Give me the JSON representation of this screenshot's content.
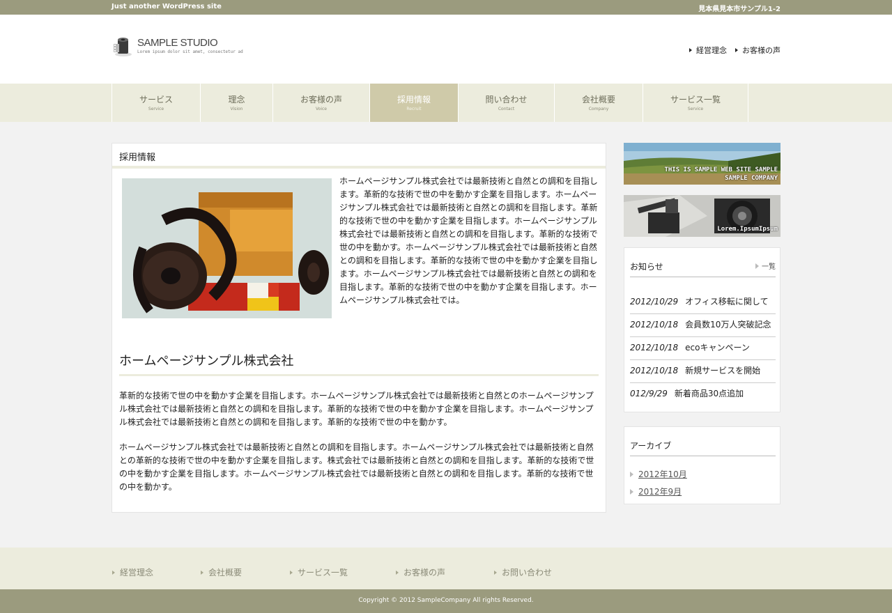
{
  "topbar": {
    "tagline": "Just another WordPress site",
    "address": "見本県見本市サンプル1-2"
  },
  "logo": {
    "name": "SAMPLE STUDIO",
    "sub": "Lorem ipsum dolor sit amet, consectetur ad"
  },
  "header_links": [
    {
      "label": "経営理念"
    },
    {
      "label": "お客様の声"
    }
  ],
  "nav": [
    {
      "jp": "サービス",
      "en": "Service"
    },
    {
      "jp": "理念",
      "en": "Vision"
    },
    {
      "jp": "お客様の声",
      "en": "Voice"
    },
    {
      "jp": "採用情報",
      "en": "Recruit",
      "active": true
    },
    {
      "jp": "問い合わせ",
      "en": "Contact"
    },
    {
      "jp": "会社概要",
      "en": "Company"
    },
    {
      "jp": "サービス一覧",
      "en": "Service"
    }
  ],
  "main": {
    "title": "採用情報",
    "intro": "ホームページサンプル株式会社では最新技術と自然との調和を目指します。革新的な技術で世の中を動かす企業を目指します。ホームページサンプル株式会社では最新技術と自然との調和を目指します。革新的な技術で世の中を動かす企業を目指します。ホームページサンプル株式会社では最新技術と自然との調和を目指します。革新的な技術で世の中を動かす。ホームページサンプル株式会社では最新技術と自然との調和を目指します。革新的な技術で世の中を動かす企業を目指します。ホームページサンプル株式会社では最新技術と自然との調和を目指します。革新的な技術で世の中を動かす企業を目指します。ホームページサンプル株式会社では。",
    "section_title": "ホームページサンプル株式会社",
    "para1": "革新的な技術で世の中を動かす企業を目指します。ホームページサンプル株式会社では最新技術と自然とのホームページサンプル株式会社では最新技術と自然との調和を目指します。革新的な技術で世の中を動かす企業を目指します。ホームページサンプル株式会社では最新技術と自然との調和を目指します。革新的な技術で世の中を動かす。",
    "para2": "ホームページサンプル株式会社では最新技術と自然との調和を目指します。ホームページサンプル株式会社では最新技術と自然との革新的な技術で世の中を動かす企業を目指します。株式会社では最新技術と自然との調和を目指します。革新的な技術で世の中を動かす企業を目指します。ホームページサンプル株式会社では最新技術と自然との調和を目指します。革新的な技術で世の中を動かす。"
  },
  "banners": {
    "b1_line1": "THIS IS SAMPLE WEB SITE SAMPLE",
    "b1_line2": "SAMPLE COMPANY",
    "b2_text": "Lorem.IpsumIpsum"
  },
  "news": {
    "title": "お知らせ",
    "more": "一覧",
    "items": [
      {
        "date": "2012/10/29",
        "text": "オフィス移転に関して"
      },
      {
        "date": "2012/10/18",
        "text": "会員数10万人突破記念"
      },
      {
        "date": "2012/10/18",
        "text": "ecoキャンペーン"
      },
      {
        "date": "2012/10/18",
        "text": "新規サービスを開始"
      },
      {
        "date": "012/9/29",
        "text": "新着商品30点追加"
      }
    ]
  },
  "archive": {
    "title": "アーカイブ",
    "items": [
      "2012年10月",
      "2012年9月"
    ]
  },
  "footer_links": [
    "経営理念",
    "会社概要",
    "サービス一覧",
    "お客様の声",
    "お問い合わせ"
  ],
  "copyright": "Copyright © 2012 SampleCompany All rights Reserved."
}
